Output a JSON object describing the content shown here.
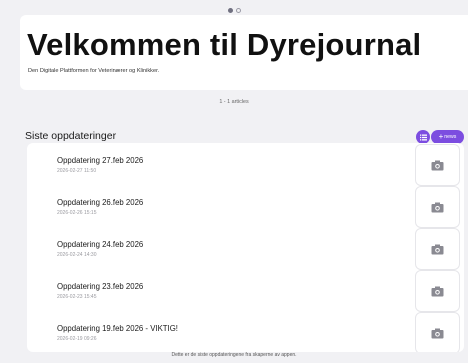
{
  "header": {
    "title": "Velkommen til Dyrejournal",
    "subtitle": "Den Digitale Plattformen for Veterinærer og Klinikker."
  },
  "articles_count": "1 - 1 articles",
  "updates": {
    "title": "Siste oppdateringer",
    "news_button_label": "news",
    "items": [
      {
        "title": "Oppdatering 27.feb 2026",
        "date": "2026-02-27 11:50"
      },
      {
        "title": "Oppdatering 26.feb 2026",
        "date": "2026-02-26 15:15"
      },
      {
        "title": "Oppdatering 24.feb 2026",
        "date": "2026-02-24 14:30"
      },
      {
        "title": "Oppdatering 23.feb 2026",
        "date": "2026-02-23 15:45"
      },
      {
        "title": "Oppdatering 19.feb 2026 - VIKTIG!",
        "date": "2026-02-19 09:26"
      }
    ]
  },
  "footer": "Dette er de siste oppdateringene fra skaperne av appen.",
  "colors": {
    "accent": "#7c4de0",
    "background": "#f1f1f4",
    "card": "#ffffff"
  },
  "icons": {
    "view_toggle": "list-icon",
    "item_thumbnail": "camera-icon"
  }
}
